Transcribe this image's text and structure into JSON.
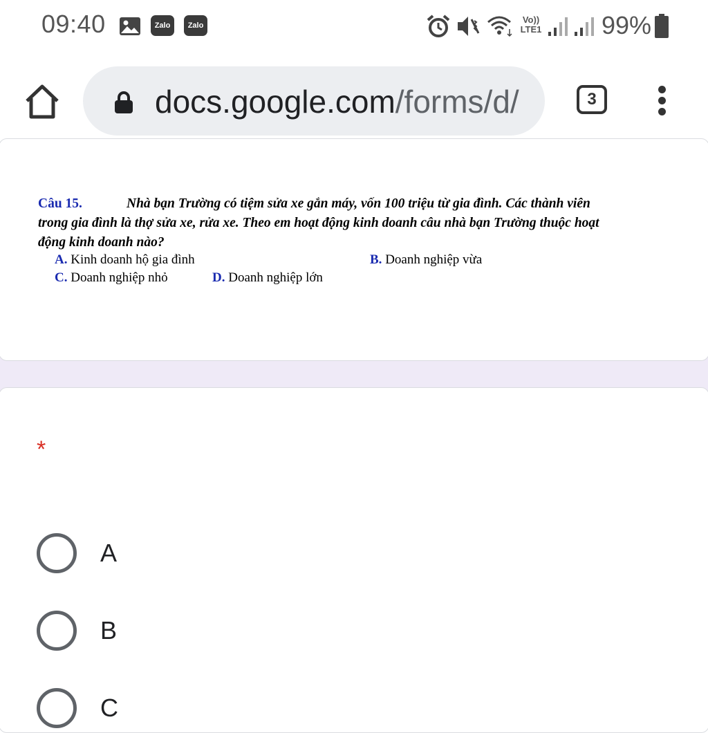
{
  "status_bar": {
    "time": "09:40",
    "battery_percent": "99%",
    "network_label": "Vo)) LTE1",
    "notification_apps": [
      "Zalo",
      "Zalo"
    ],
    "icons": [
      "image-icon",
      "alarm-icon",
      "vibrate-icon",
      "wifi-icon",
      "signal-icon",
      "signal-icon",
      "battery-icon"
    ]
  },
  "browser": {
    "url_domain": "docs.google.com",
    "url_path": "/forms/d/",
    "tab_count": "3"
  },
  "question": {
    "number": "Câu 15.",
    "text_line1": "Nhà bạn Trường có tiệm sửa xe gắn máy, vốn 100 triệu từ gia đình. Các thành viên",
    "text_line2": "trong gia đình là thợ sửa xe, rửa xe. Theo em hoạt động kinh doanh câu nhà bạn Trường thuộc hoạt",
    "text_line3": "động kinh doanh nào?",
    "options": [
      {
        "letter": "A.",
        "text": "Kinh doanh hộ gia đình"
      },
      {
        "letter": "B.",
        "text": "Doanh nghiệp vừa"
      },
      {
        "letter": "C.",
        "text": "Doanh nghiệp nhỏ"
      },
      {
        "letter": "D.",
        "text": "Doanh nghiệp lớn"
      }
    ]
  },
  "answer_card": {
    "required_mark": "*",
    "choices": [
      "A",
      "B",
      "C"
    ]
  },
  "colors": {
    "page_background": "#efeaf7",
    "required": "#d93025",
    "option_letter": "#1a2bb0"
  }
}
